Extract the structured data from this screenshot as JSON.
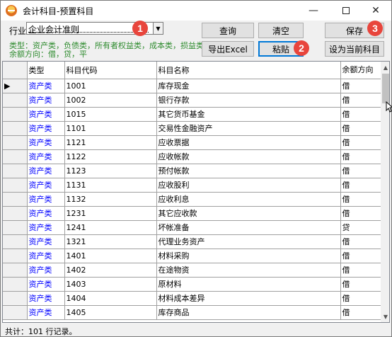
{
  "window": {
    "title": "会计科目-预置科目",
    "minimize": "—",
    "close": "✕"
  },
  "toolbar": {
    "industry_label": "行业",
    "industry_value": "企业会计准则",
    "query": "查询",
    "clear": "清空",
    "save": "保存",
    "export_excel": "导出Excel",
    "paste": "粘贴",
    "set_current": "设为当前科目"
  },
  "badges": [
    "1",
    "2",
    "3"
  ],
  "info": {
    "line1": "类型：资产类，负债类，所有者权益类，成本类，损益类",
    "line2": "余额方向：借，贷，平"
  },
  "grid": {
    "headers": {
      "type": "类型",
      "code": "科目代码",
      "name": "科目名称",
      "balance": "余额方向"
    },
    "current_row_marker": "▶",
    "rows": [
      {
        "type": "资产类",
        "code": "1001",
        "name": "库存现金",
        "dir": "借"
      },
      {
        "type": "资产类",
        "code": "1002",
        "name": "银行存款",
        "dir": "借"
      },
      {
        "type": "资产类",
        "code": "1015",
        "name": "其它货币基金",
        "dir": "借"
      },
      {
        "type": "资产类",
        "code": "1101",
        "name": "交易性金融资产",
        "dir": "借"
      },
      {
        "type": "资产类",
        "code": "1121",
        "name": "应收票据",
        "dir": "借"
      },
      {
        "type": "资产类",
        "code": "1122",
        "name": "应收帐款",
        "dir": "借"
      },
      {
        "type": "资产类",
        "code": "1123",
        "name": "预付帐款",
        "dir": "借"
      },
      {
        "type": "资产类",
        "code": "1131",
        "name": "应收股利",
        "dir": "借"
      },
      {
        "type": "资产类",
        "code": "1132",
        "name": "应收利息",
        "dir": "借"
      },
      {
        "type": "资产类",
        "code": "1231",
        "name": "其它应收款",
        "dir": "借"
      },
      {
        "type": "资产类",
        "code": "1241",
        "name": "坏帐准备",
        "dir": "贷"
      },
      {
        "type": "资产类",
        "code": "1321",
        "name": "代理业务资产",
        "dir": "借"
      },
      {
        "type": "资产类",
        "code": "1401",
        "name": "材料采购",
        "dir": "借"
      },
      {
        "type": "资产类",
        "code": "1402",
        "name": "在途物资",
        "dir": "借"
      },
      {
        "type": "资产类",
        "code": "1403",
        "name": "原材料",
        "dir": "借"
      },
      {
        "type": "资产类",
        "code": "1404",
        "name": "材料成本差异",
        "dir": "借"
      },
      {
        "type": "资产类",
        "code": "1405",
        "name": "库存商品",
        "dir": "借"
      }
    ]
  },
  "status": "共计：101 行记录。",
  "colors": {
    "badge": "#e8453c",
    "info_text": "#2e8b2e",
    "type_text": "#0000ff",
    "focus_border": "#0078d7"
  }
}
